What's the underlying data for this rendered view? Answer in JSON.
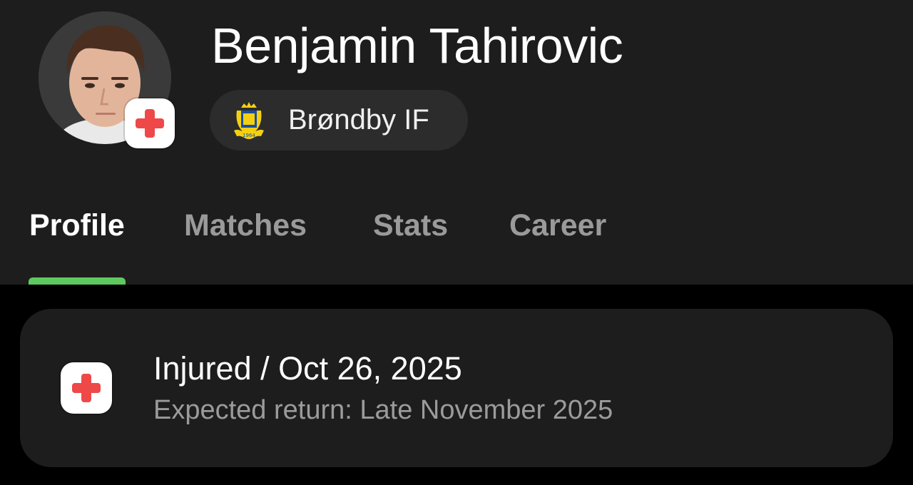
{
  "player": {
    "name": "Benjamin Tahirovic",
    "avatar_icon": "player-portrait",
    "badge_icon": "medical-cross-icon"
  },
  "club": {
    "name": "Brøndby IF",
    "logo_icon": "brondby-crest-icon",
    "crest_year": "1964"
  },
  "tabs": [
    {
      "label": "Profile",
      "active": true
    },
    {
      "label": "Matches",
      "active": false
    },
    {
      "label": "Stats",
      "active": false
    },
    {
      "label": "Career",
      "active": false
    }
  ],
  "injury": {
    "title": "Injured / Oct 26, 2025",
    "subtitle": "Expected return: Late November 2025",
    "icon": "medical-cross-icon"
  },
  "colors": {
    "background": "#000000",
    "surface": "#1d1d1d",
    "chip": "#2c2c2c",
    "accent": "#5dc95e",
    "injury_red": "#ee4848",
    "muted_text": "#9b9b9b"
  }
}
